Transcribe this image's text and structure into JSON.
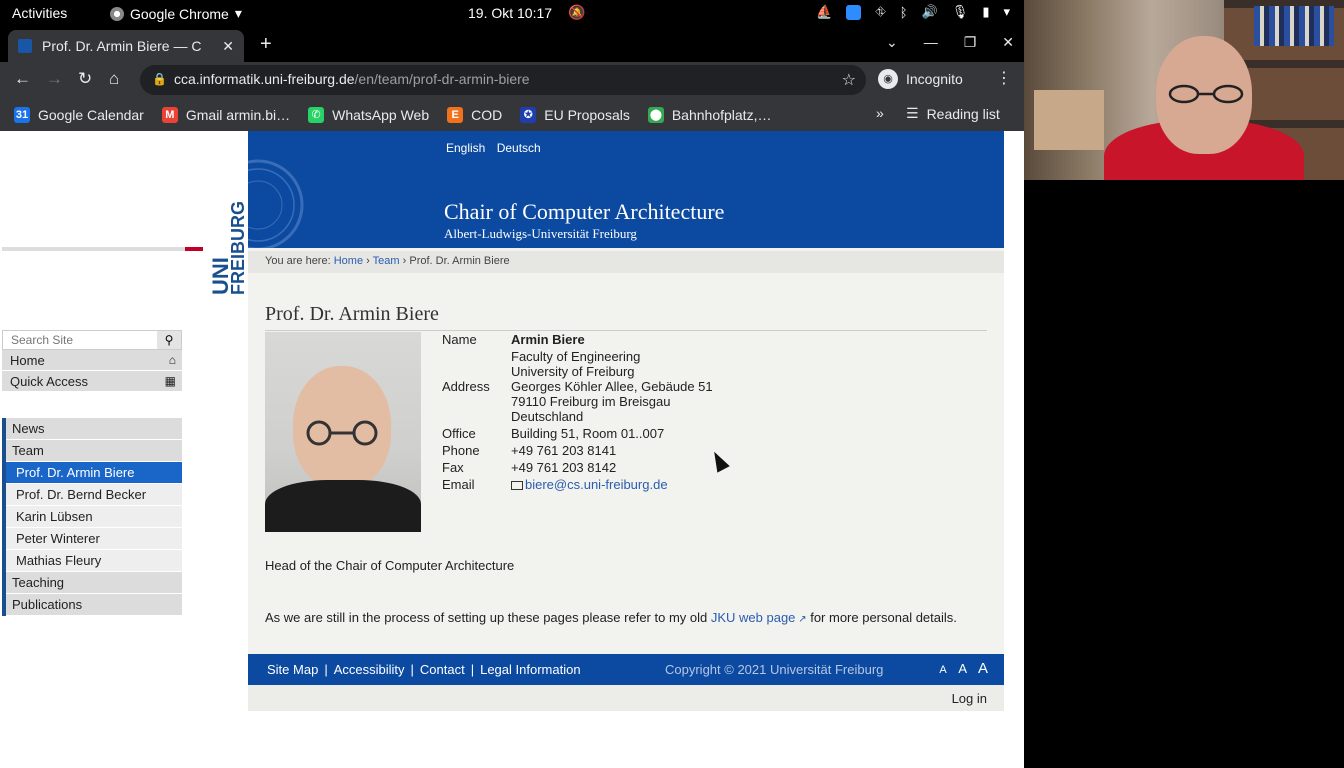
{
  "topbar": {
    "activities": "Activities",
    "app": "Google Chrome",
    "clock": "19. Okt  10:17"
  },
  "browser": {
    "tab_title": "Prof. Dr. Armin Biere — C",
    "url_host": "cca.informatik.uni-freiburg.de",
    "url_path": "/en/team/prof-dr-armin-biere",
    "incognito_label": "Incognito",
    "bookmarks": [
      {
        "label": "Google Calendar",
        "color": "#1a73e8",
        "icon": "calendar-icon",
        "glyph": "31"
      },
      {
        "label": "Gmail armin.bi…",
        "color": "#ea4335",
        "icon": "gmail-icon",
        "glyph": "M"
      },
      {
        "label": "WhatsApp Web",
        "color": "#25d366",
        "icon": "whatsapp-icon",
        "glyph": "✆"
      },
      {
        "label": "COD",
        "color": "#f2711c",
        "icon": "cod-icon",
        "glyph": "E"
      },
      {
        "label": "EU Proposals",
        "color": "#1f3fb0",
        "icon": "eu-icon",
        "glyph": "✪"
      },
      {
        "label": "Bahnhofplatz,…",
        "color": "#34a853",
        "icon": "maps-pin-icon",
        "glyph": "⬤"
      }
    ],
    "reading_list": "Reading list"
  },
  "site": {
    "lang_en": "English",
    "lang_de": "Deutsch",
    "title": "Chair of Computer Architecture",
    "subtitle": "Albert-Ludwigs-Universität Freiburg",
    "logo_uni": "UNI",
    "logo_freiburg": "FREIBURG",
    "search_placeholder": "Search Site",
    "home": "Home",
    "quick_access": "Quick Access",
    "menu": [
      {
        "label": "News",
        "level": 0
      },
      {
        "label": "Team",
        "level": 0
      },
      {
        "label": "Prof. Dr. Armin Biere",
        "level": 1,
        "active": true
      },
      {
        "label": "Prof. Dr. Bernd Becker",
        "level": 1
      },
      {
        "label": "Karin Lübsen",
        "level": 1
      },
      {
        "label": "Peter Winterer",
        "level": 1
      },
      {
        "label": "Mathias Fleury",
        "level": 1
      },
      {
        "label": "Teaching",
        "level": 0
      },
      {
        "label": "Publications",
        "level": 0
      }
    ],
    "breadcrumb": {
      "prefix": "You are here:",
      "home": "Home",
      "team": "Team",
      "current": "Prof. Dr. Armin Biere",
      "sep": "›"
    },
    "page_title": "Prof. Dr. Armin Biere",
    "contact": {
      "name_label": "Name",
      "name": "Armin Biere",
      "address_label": "Address",
      "address_lines": [
        "Faculty of Engineering",
        "University of Freiburg",
        "Georges Köhler Allee, Gebäude 51",
        "79110 Freiburg im Breisgau",
        "Deutschland"
      ],
      "office_label": "Office",
      "office": "Building 51, Room 01..007",
      "phone_label": "Phone",
      "phone": "+49 761 203 8141",
      "fax_label": "Fax",
      "fax": "+49 761 203 8142",
      "email_label": "Email",
      "email": "biere@cs.uni-freiburg.de"
    },
    "head_of": "Head of the Chair of Computer Architecture",
    "note_before": "As we are still in the process of setting up these pages please refer to my old ",
    "note_link": "JKU web page",
    "note_after": " for more personal details.",
    "footer": {
      "sitemap": "Site Map",
      "accessibility": "Accessibility",
      "contact": "Contact",
      "legal": "Legal Information",
      "copyright": "Copyright © 2021 Universität Freiburg",
      "font_small": "A",
      "font_mid": "A",
      "font_large": "A"
    },
    "login": "Log in"
  }
}
